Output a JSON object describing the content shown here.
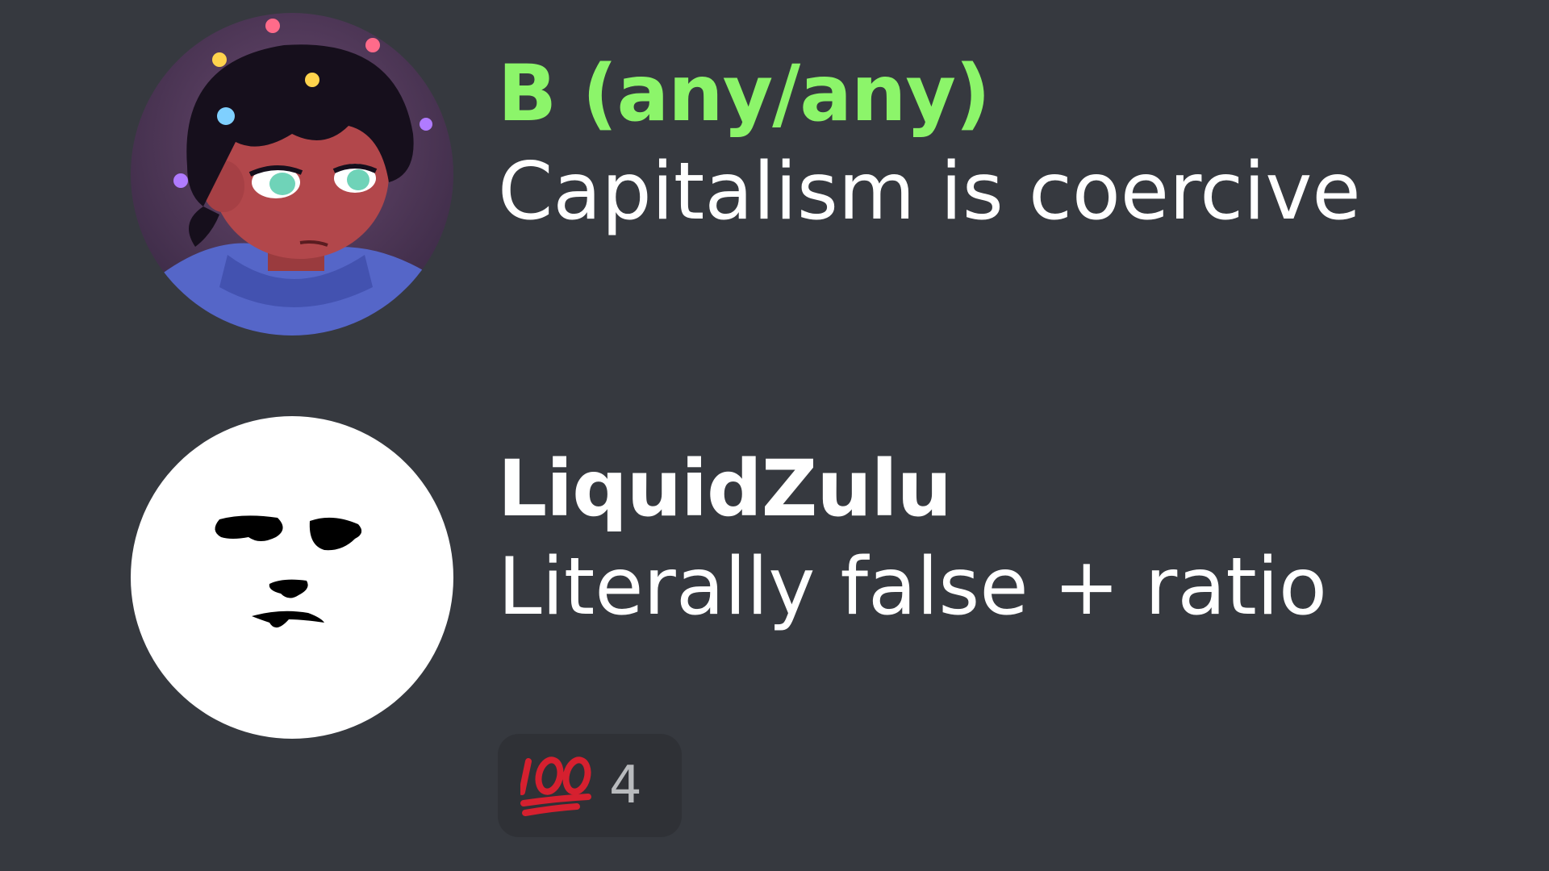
{
  "messages": [
    {
      "username": "B (any/any)",
      "username_color": "#8cf56a",
      "text": "Capitalism is coercive",
      "avatar_icon": "cartoon-person-with-flowers-avatar"
    },
    {
      "username": "LiquidZulu",
      "username_color": "#ffffff",
      "text": "Literally false + ratio",
      "avatar_icon": "ink-face-avatar",
      "reaction": {
        "emoji_icon": "hundred-points-emoji",
        "count": "4"
      }
    }
  ],
  "theme": {
    "background": "#36393f",
    "reaction_background": "#2f3136",
    "text_color": "#ffffff",
    "reaction_count_color": "#b9bbbe"
  }
}
